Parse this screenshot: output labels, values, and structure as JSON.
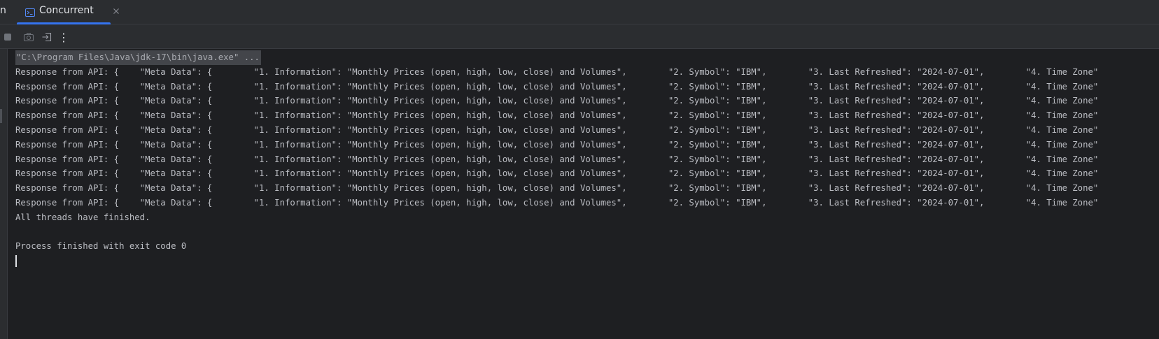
{
  "tabs": {
    "partial_label": "n",
    "active": {
      "label": "Concurrent",
      "icon": "console-icon",
      "close": "×"
    }
  },
  "toolbar": {
    "buttons": [
      {
        "name": "stop-icon"
      },
      {
        "name": "camera-icon"
      },
      {
        "name": "exit-icon"
      },
      {
        "name": "more-options-icon",
        "glyph": "⋮"
      }
    ]
  },
  "console": {
    "command": "\"C:\\Program Files\\Java\\jdk-17\\bin\\java.exe\" ...",
    "response_lines": [
      "Response from API: {    \"Meta Data\": {        \"1. Information\": \"Monthly Prices (open, high, low, close) and Volumes\",        \"2. Symbol\": \"IBM\",        \"3. Last Refreshed\": \"2024-07-01\",        \"4. Time Zone\"",
      "Response from API: {    \"Meta Data\": {        \"1. Information\": \"Monthly Prices (open, high, low, close) and Volumes\",        \"2. Symbol\": \"IBM\",        \"3. Last Refreshed\": \"2024-07-01\",        \"4. Time Zone\"",
      "Response from API: {    \"Meta Data\": {        \"1. Information\": \"Monthly Prices (open, high, low, close) and Volumes\",        \"2. Symbol\": \"IBM\",        \"3. Last Refreshed\": \"2024-07-01\",        \"4. Time Zone\"",
      "Response from API: {    \"Meta Data\": {        \"1. Information\": \"Monthly Prices (open, high, low, close) and Volumes\",        \"2. Symbol\": \"IBM\",        \"3. Last Refreshed\": \"2024-07-01\",        \"4. Time Zone\"",
      "Response from API: {    \"Meta Data\": {        \"1. Information\": \"Monthly Prices (open, high, low, close) and Volumes\",        \"2. Symbol\": \"IBM\",        \"3. Last Refreshed\": \"2024-07-01\",        \"4. Time Zone\"",
      "Response from API: {    \"Meta Data\": {        \"1. Information\": \"Monthly Prices (open, high, low, close) and Volumes\",        \"2. Symbol\": \"IBM\",        \"3. Last Refreshed\": \"2024-07-01\",        \"4. Time Zone\"",
      "Response from API: {    \"Meta Data\": {        \"1. Information\": \"Monthly Prices (open, high, low, close) and Volumes\",        \"2. Symbol\": \"IBM\",        \"3. Last Refreshed\": \"2024-07-01\",        \"4. Time Zone\"",
      "Response from API: {    \"Meta Data\": {        \"1. Information\": \"Monthly Prices (open, high, low, close) and Volumes\",        \"2. Symbol\": \"IBM\",        \"3. Last Refreshed\": \"2024-07-01\",        \"4. Time Zone\"",
      "Response from API: {    \"Meta Data\": {        \"1. Information\": \"Monthly Prices (open, high, low, close) and Volumes\",        \"2. Symbol\": \"IBM\",        \"3. Last Refreshed\": \"2024-07-01\",        \"4. Time Zone\"",
      "Response from API: {    \"Meta Data\": {        \"1. Information\": \"Monthly Prices (open, high, low, close) and Volumes\",        \"2. Symbol\": \"IBM\",        \"3. Last Refreshed\": \"2024-07-01\",        \"4. Time Zone\""
    ],
    "finished_line": "All threads have finished.",
    "exit_line": "Process finished with exit code 0"
  },
  "colors": {
    "background": "#1e1f22",
    "panel": "#2b2d30",
    "text": "#bcbec4",
    "accent": "#3574f0",
    "command_highlight": "#43454a"
  }
}
